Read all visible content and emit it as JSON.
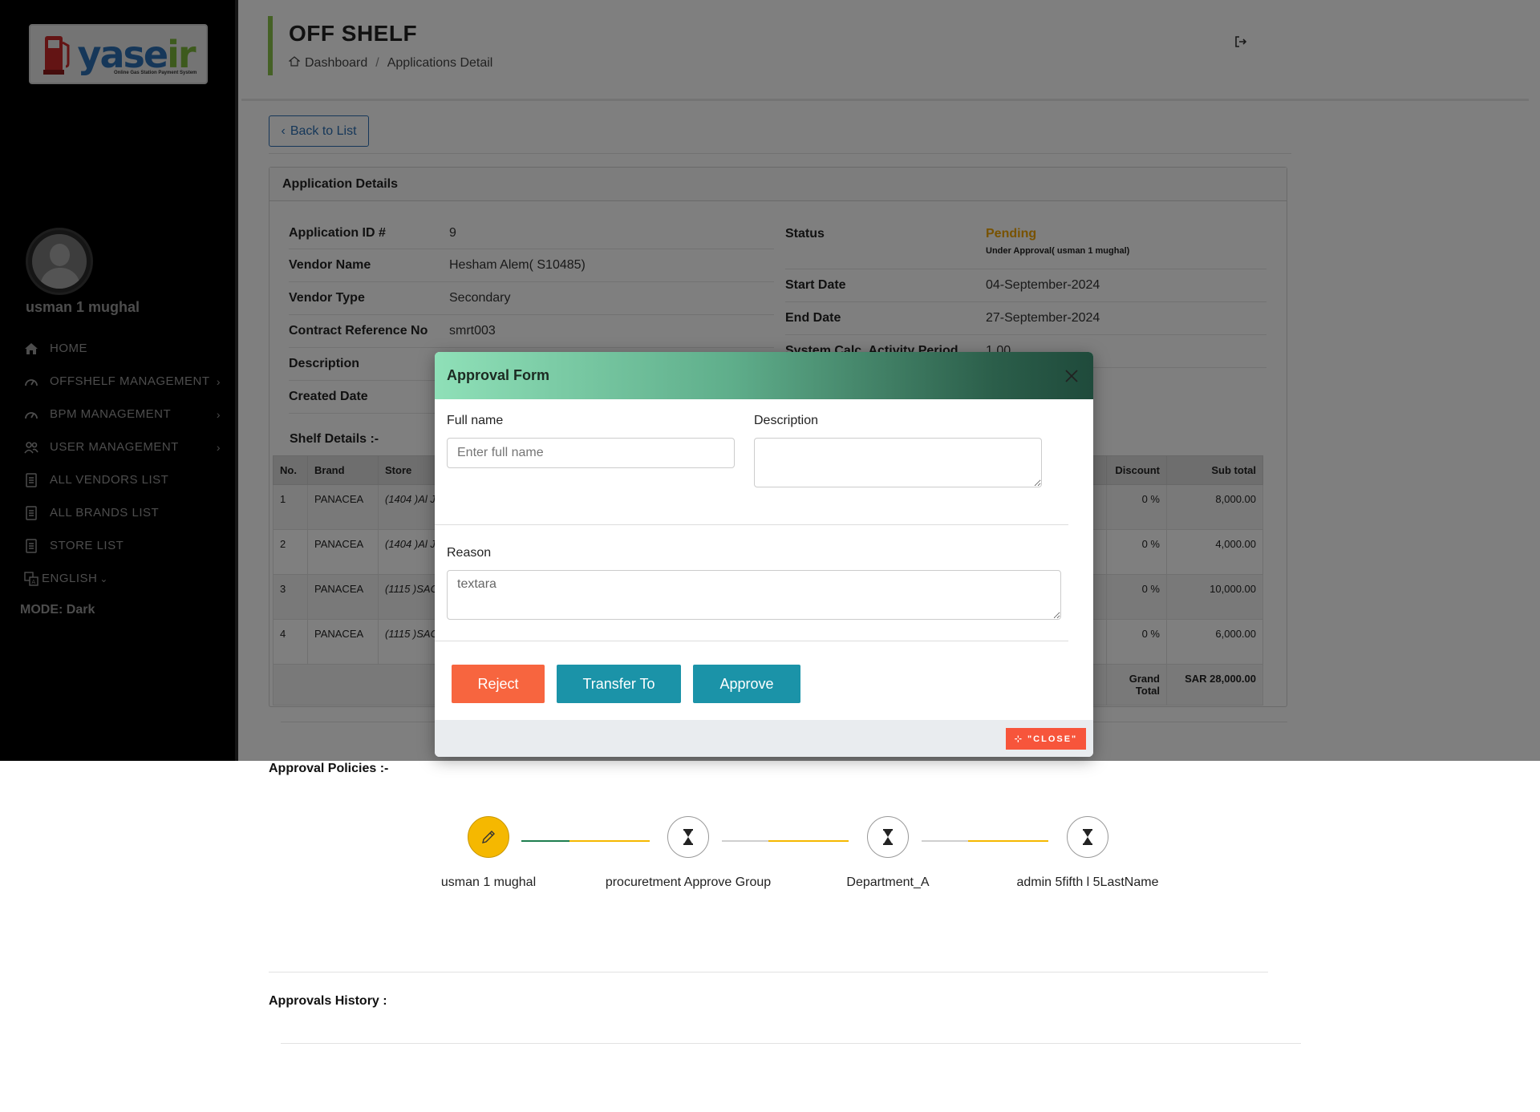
{
  "sidebar": {
    "logo_text_blue": "yase",
    "logo_text_green": "ir",
    "logo_sub": "Online Gas Station Payment System",
    "user_name": "usman 1 mughal",
    "items": [
      {
        "label": "HOME",
        "icon": "home-icon"
      },
      {
        "label": "OFFSHELF MANAGEMENT",
        "icon": "gauge-icon",
        "chevron": "›"
      },
      {
        "label": "BPM MANAGEMENT",
        "icon": "gauge-icon",
        "chevron": "›"
      },
      {
        "label": "USER MANAGEMENT",
        "icon": "users-icon",
        "chevron": "›"
      },
      {
        "label": "ALL VENDORS LIST",
        "icon": "list-icon"
      },
      {
        "label": "ALL BRANDS LIST",
        "icon": "list-icon"
      },
      {
        "label": "STORE LIST",
        "icon": "list-icon"
      }
    ],
    "language": "ENGLISH",
    "mode": "MODE: Dark"
  },
  "header": {
    "title": "OFF SHELF",
    "breadcrumb": [
      "Dashboard",
      "Applications Detail"
    ],
    "breadcrumb_sep": "/"
  },
  "main": {
    "back_label": "Back to List",
    "card_title": "Application Details",
    "left_fields": [
      {
        "key": "Application ID #",
        "value": "9"
      },
      {
        "key": "Vendor Name",
        "value": "Hesham Alem( S10485)"
      },
      {
        "key": "Vendor Type",
        "value": "Secondary"
      },
      {
        "key": "Contract Reference No",
        "value": "smrt003"
      },
      {
        "key": "Description",
        "value": ""
      },
      {
        "key": "Created Date",
        "value": ""
      }
    ],
    "right_fields": [
      {
        "key": "Status",
        "value": "Pending",
        "sub": "Under Approval( usman 1 mughal)"
      },
      {
        "key": "Start Date",
        "value": "04-September-2024"
      },
      {
        "key": "End Date",
        "value": "27-September-2024"
      },
      {
        "key": "System Calc. Activity Period",
        "value": "1.00"
      }
    ],
    "status_color": "#f0a500",
    "shelf_title": "Shelf Details :-",
    "table": {
      "headers": [
        "No.",
        "Brand",
        "Store",
        "Discount",
        "Sub total"
      ],
      "rows": [
        {
          "no": "1",
          "brand": "PANACEA",
          "store": "(1404 )Al J",
          "discount": "0 %",
          "subtotal": "8,000.00"
        },
        {
          "no": "2",
          "brand": "PANACEA",
          "store": "(1404 )Al J",
          "discount": "0 %",
          "subtotal": "4,000.00"
        },
        {
          "no": "3",
          "brand": "PANACEA",
          "store": "(1115 )SAC",
          "discount": "0 %",
          "subtotal": "10,000.00"
        },
        {
          "no": "4",
          "brand": "PANACEA",
          "store": "(1115 )SAC",
          "discount": "0 %",
          "subtotal": "6,000.00"
        }
      ],
      "grand_total_label": "Grand Total",
      "grand_total_value": "SAR 28,000.00"
    },
    "policies_title": "Approval Policies :-",
    "steps": [
      {
        "label": "usman 1 mughal",
        "icon": "pencil-icon",
        "active": true
      },
      {
        "label": "procuretment Approve Group",
        "icon": "hourglass-icon",
        "active": false
      },
      {
        "label": "Department_A",
        "icon": "hourglass-icon",
        "active": false
      },
      {
        "label": "admin 5fifth l 5LastName",
        "icon": "hourglass-icon",
        "active": false
      }
    ],
    "history_title": "Approvals History :"
  },
  "modal": {
    "title": "Approval Form",
    "full_name_label": "Full name",
    "full_name_placeholder": "Enter full name",
    "description_label": "Description",
    "reason_label": "Reason",
    "reason_value": "textara",
    "reject_label": "Reject",
    "transfer_label": "Transfer To",
    "approve_label": "Approve",
    "close_badge": "\"CLOSE\""
  },
  "colors": {
    "accent_green": "#8bc34a",
    "primary_blue": "#2c6fb3",
    "teal": "#1b93a8",
    "reject": "#f7653f"
  }
}
